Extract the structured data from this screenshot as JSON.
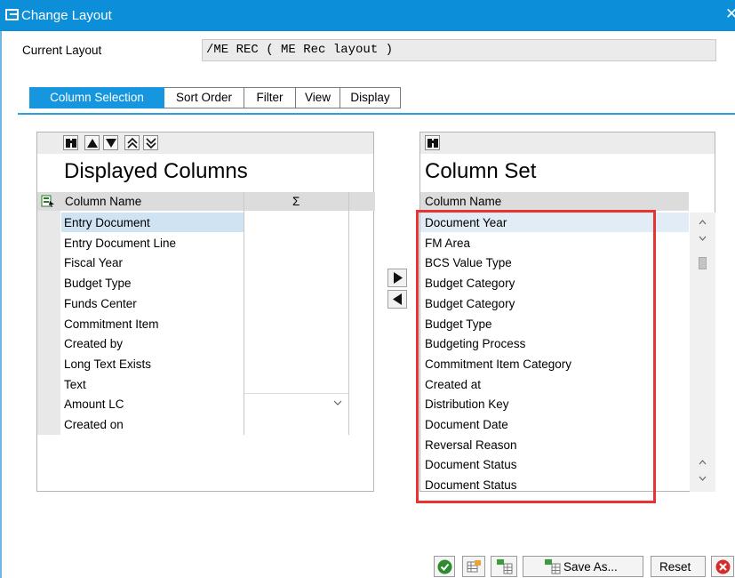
{
  "window": {
    "title": "Change Layout"
  },
  "current_layout": {
    "label": "Current Layout",
    "value": "/ME REC ( ME Rec layout )"
  },
  "tabs": [
    {
      "label": "Column Selection",
      "active": true
    },
    {
      "label": "Sort Order",
      "active": false
    },
    {
      "label": "Filter",
      "active": false
    },
    {
      "label": "View",
      "active": false
    },
    {
      "label": "Display",
      "active": false
    }
  ],
  "displayed": {
    "title": "Displayed Columns",
    "header_name": "Column Name",
    "header_sum": "Σ",
    "rows": [
      "Entry Document",
      "Entry Document Line",
      "Fiscal Year",
      "Budget Type",
      "Funds Center",
      "Commitment Item",
      "Created by",
      "Long Text Exists",
      "Text",
      "Amount LC",
      "Created on"
    ]
  },
  "column_set": {
    "title": "Column Set",
    "header_name": "Column Name",
    "rows": [
      "Document Year",
      "FM Area",
      "BCS Value Type",
      "Budget Category",
      "Budget Category",
      "Budget Type",
      "Budgeting Process",
      "Commitment Item Category",
      "Created at",
      "Distribution Key",
      "Document Date",
      "Reversal Reason",
      "Document Status",
      "Document Status"
    ]
  },
  "footer": {
    "save_as_label": "Save As...",
    "reset_label": "Reset"
  },
  "colors": {
    "title_bar": "#0c8ed9",
    "active_tab": "#1596de",
    "selected_row": "#cfe3f3",
    "highlight_box": "#e63333"
  }
}
